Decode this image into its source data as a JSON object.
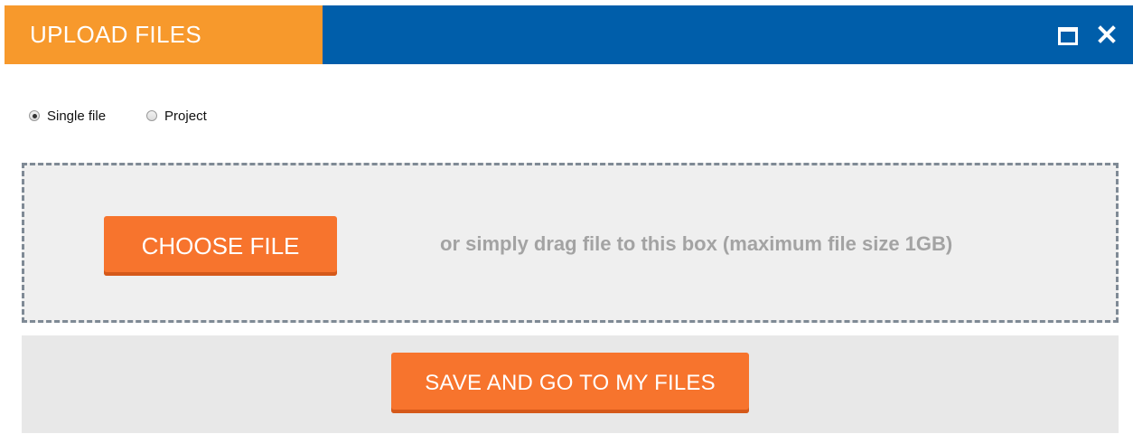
{
  "window": {
    "title": "UPLOAD FILES",
    "maximize_icon": "maximize-icon",
    "close_icon": "close-icon"
  },
  "upload_type": {
    "options": [
      {
        "label": "Single file",
        "selected": true
      },
      {
        "label": "Project",
        "selected": false
      }
    ]
  },
  "drop_zone": {
    "choose_label": "CHOOSE FILE",
    "hint": "or simply drag file to this box (maximum file size 1GB)"
  },
  "footer": {
    "save_label": "SAVE AND GO TO MY FILES"
  },
  "colors": {
    "title_tab": "#f7992c",
    "title_bar": "#005eaa",
    "button": "#f7742d",
    "drop_zone_bg": "#efefef",
    "footer_bg": "#e8e8e8",
    "hint_text": "#a3a3a3"
  }
}
